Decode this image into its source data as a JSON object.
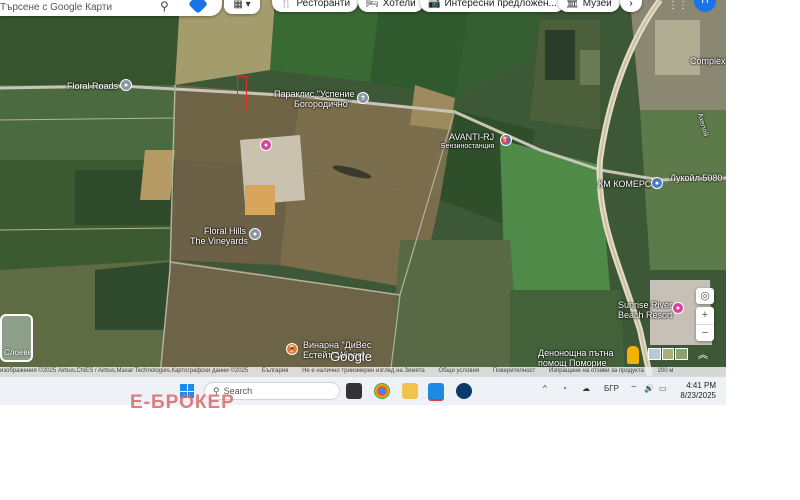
{
  "search": {
    "placeholder": "Търсене с Google Карти"
  },
  "chips": [
    {
      "label": "Ресторанти",
      "icon": "fork-knife-icon"
    },
    {
      "label": "Хотели",
      "icon": "bed-icon"
    },
    {
      "label": "Интересни предложен...",
      "icon": "camera-icon"
    },
    {
      "label": "Музеи",
      "icon": "museum-icon"
    }
  ],
  "avatar": {
    "initial": "П"
  },
  "places": {
    "floral_roads": "Floral Roads",
    "paraklis_1": "Параклис \"Успение",
    "paraklis_2": "Богородично\"",
    "avanti_1": "AVANTI-RJ",
    "avanti_2": "Бензиностанция",
    "km_komers": "КМ КОМЕРС",
    "lukoil": "Лукойл 5080",
    "floral_hills_1": "Floral Hills",
    "floral_hills_2": "The Vineyards",
    "sunrise_1": "Sunrise River",
    "sunrise_2": "Beach Resort",
    "vinarna_1": "Винарна \"ДиВес",
    "vinarna_2": "Естейт\" Winery",
    "denonoshtna_1": "Денонощна пътна",
    "denonoshtna_2": "помощ Поморие",
    "complex": "Complex",
    "road_label": "Ахелой"
  },
  "layers": {
    "label": "Слоеве"
  },
  "google_logo": "Google",
  "attribution": [
    "изображения ©2025 Airbus,CNES / Airbus,Maxar Technologies,Картографски данни ©2025",
    "България",
    "Не е налично триизмерен изглед на Земята",
    "Общи условия",
    "Поверителност",
    "Изпращане на отзиви за продукта",
    "200 м"
  ],
  "taskbar": {
    "search_placeholder": "Search",
    "lang": "БГР",
    "time": "4:41 PM",
    "date": "8/23/2025"
  },
  "watermark": "Е-БРОКЕР",
  "colors": {
    "map_dark": "#3f5a36",
    "field_light": "#8f8b63",
    "road": "#c9c6bd",
    "accent_blue": "#1a73e8",
    "highlight_red": "#e0302a",
    "watermark": "#d66868"
  }
}
